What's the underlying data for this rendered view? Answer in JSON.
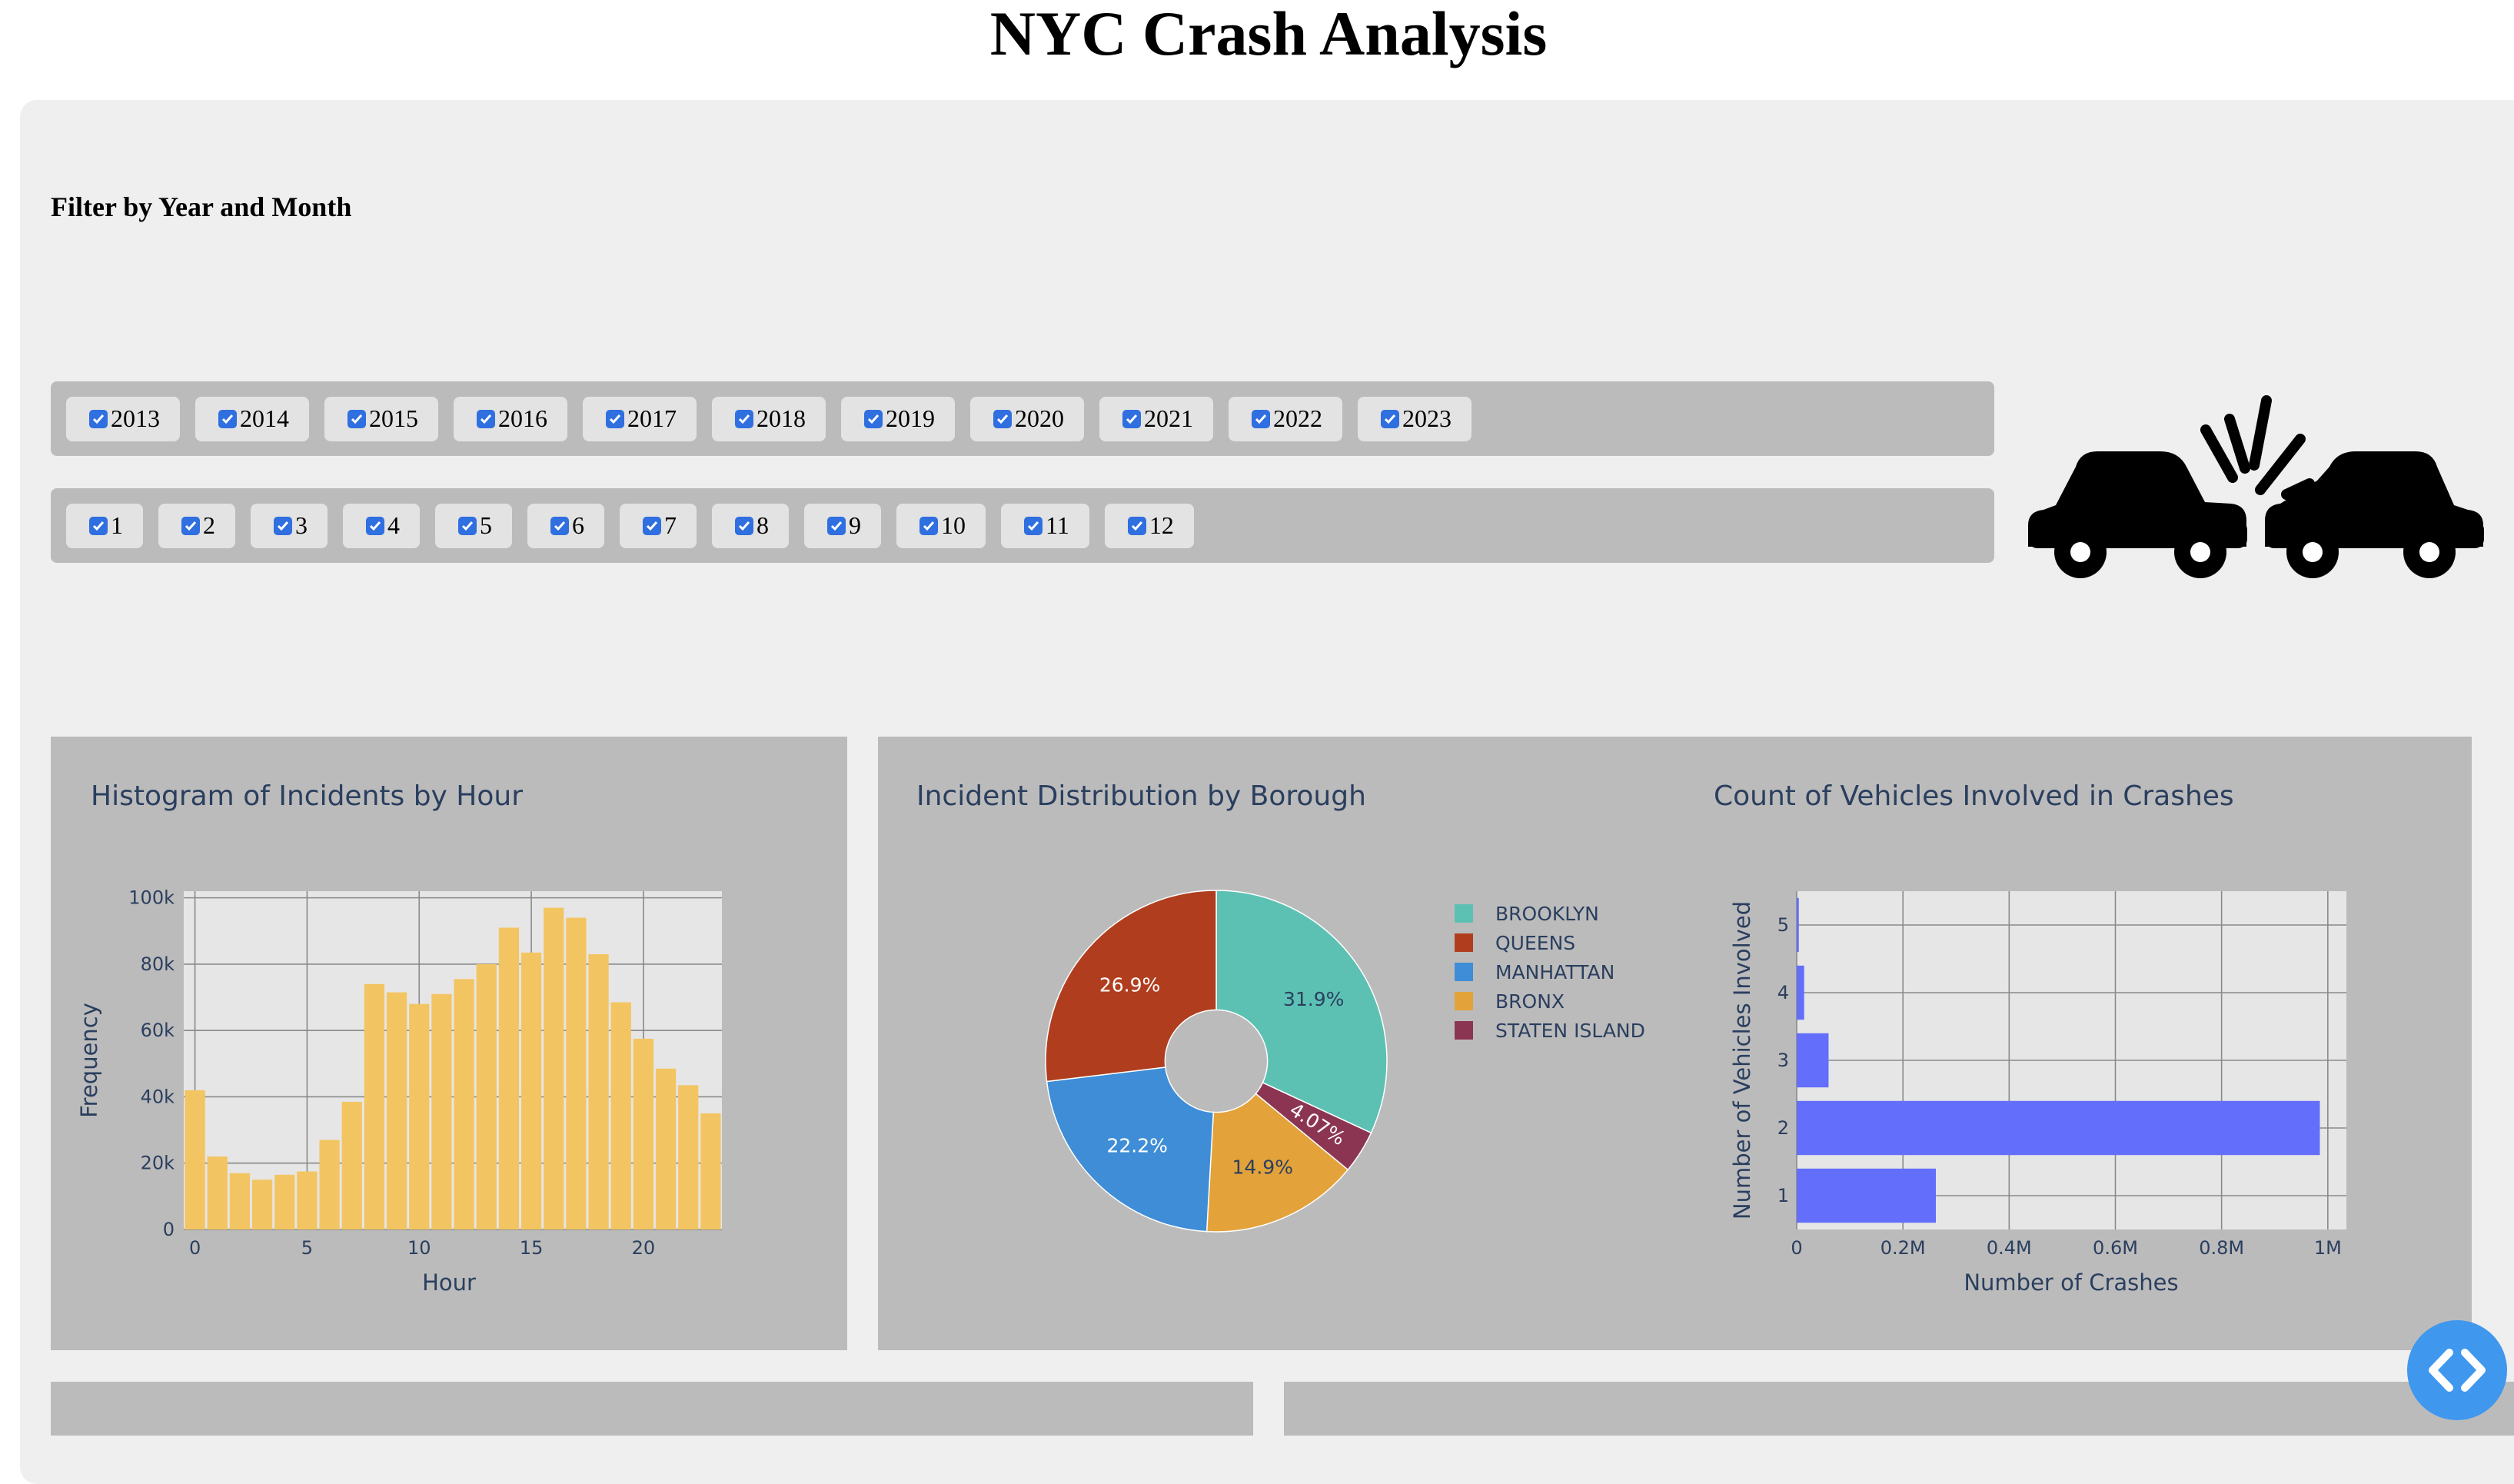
{
  "page": {
    "title": "NYC Crash Analysis"
  },
  "filters": {
    "label": "Filter by Year and Month",
    "years": [
      "2013",
      "2014",
      "2015",
      "2016",
      "2017",
      "2018",
      "2019",
      "2020",
      "2021",
      "2022",
      "2023"
    ],
    "months": [
      "1",
      "2",
      "3",
      "4",
      "5",
      "6",
      "7",
      "8",
      "9",
      "10",
      "11",
      "12"
    ],
    "all_checked": true,
    "checkbox_color": "#2f6fe0"
  },
  "crash_icon": {
    "icon": "car-crash-icon"
  },
  "chart_data": [
    {
      "type": "bar",
      "title": "Histogram of Incidents by Hour",
      "xlabel": "Hour",
      "ylabel": "Frequency",
      "categories": [
        0,
        1,
        2,
        3,
        4,
        5,
        6,
        7,
        8,
        9,
        10,
        11,
        12,
        13,
        14,
        15,
        16,
        17,
        18,
        19,
        20,
        21,
        22,
        23
      ],
      "values": [
        42000,
        22000,
        17000,
        15000,
        16500,
        17500,
        27000,
        38500,
        74000,
        71500,
        68000,
        71000,
        75500,
        80000,
        91000,
        83500,
        97000,
        94000,
        83000,
        68500,
        57500,
        48500,
        43500,
        35000
      ],
      "x_ticks": [
        0,
        5,
        10,
        15,
        20
      ],
      "x_tick_labels": [
        "0",
        "5",
        "10",
        "15",
        "20"
      ],
      "y_ticks": [
        0,
        20000,
        40000,
        60000,
        80000,
        100000
      ],
      "y_tick_labels": [
        "0",
        "20k",
        "40k",
        "60k",
        "80k",
        "100k"
      ],
      "xlim": [
        -0.5,
        23.5
      ],
      "ylim": [
        0,
        102000
      ],
      "grid": true,
      "bar_color": "#f3c562"
    },
    {
      "type": "pie",
      "title": "Incident Distribution by Borough",
      "hole": 0.3,
      "labels": [
        "BROOKLYN",
        "QUEENS",
        "MANHATTAN",
        "BRONX",
        "STATEN ISLAND"
      ],
      "values": [
        31.9,
        26.9,
        22.2,
        14.9,
        4.07
      ],
      "value_labels": [
        "31.9%",
        "26.9%",
        "22.2%",
        "14.9%",
        "4.07%"
      ],
      "slice_order_clockwise": [
        "BROOKLYN",
        "STATEN ISLAND",
        "BRONX",
        "MANHATTAN",
        "QUEENS"
      ],
      "colors": {
        "BROOKLYN": "#5cc1b3",
        "QUEENS": "#b03e1e",
        "MANHATTAN": "#3e8dd6",
        "BRONX": "#e3a23a",
        "STATEN ISLAND": "#8b3553"
      },
      "legend_position": "right"
    },
    {
      "type": "bar",
      "orientation": "horizontal",
      "title": "Count of Vehicles Involved in Crashes",
      "xlabel": "Number of Crashes",
      "ylabel": "Number of Vehicles Involved",
      "categories": [
        1,
        2,
        3,
        4,
        5
      ],
      "values": [
        262000,
        985000,
        60000,
        14000,
        4000
      ],
      "x_ticks": [
        0,
        200000,
        400000,
        600000,
        800000,
        1000000
      ],
      "x_tick_labels": [
        "0",
        "0.2M",
        "0.4M",
        "0.6M",
        "0.8M",
        "1M"
      ],
      "xlim": [
        0,
        1035000
      ],
      "grid": true,
      "bar_color": "#636efa"
    }
  ],
  "toggle": {
    "icon": "code-arrows-icon"
  }
}
